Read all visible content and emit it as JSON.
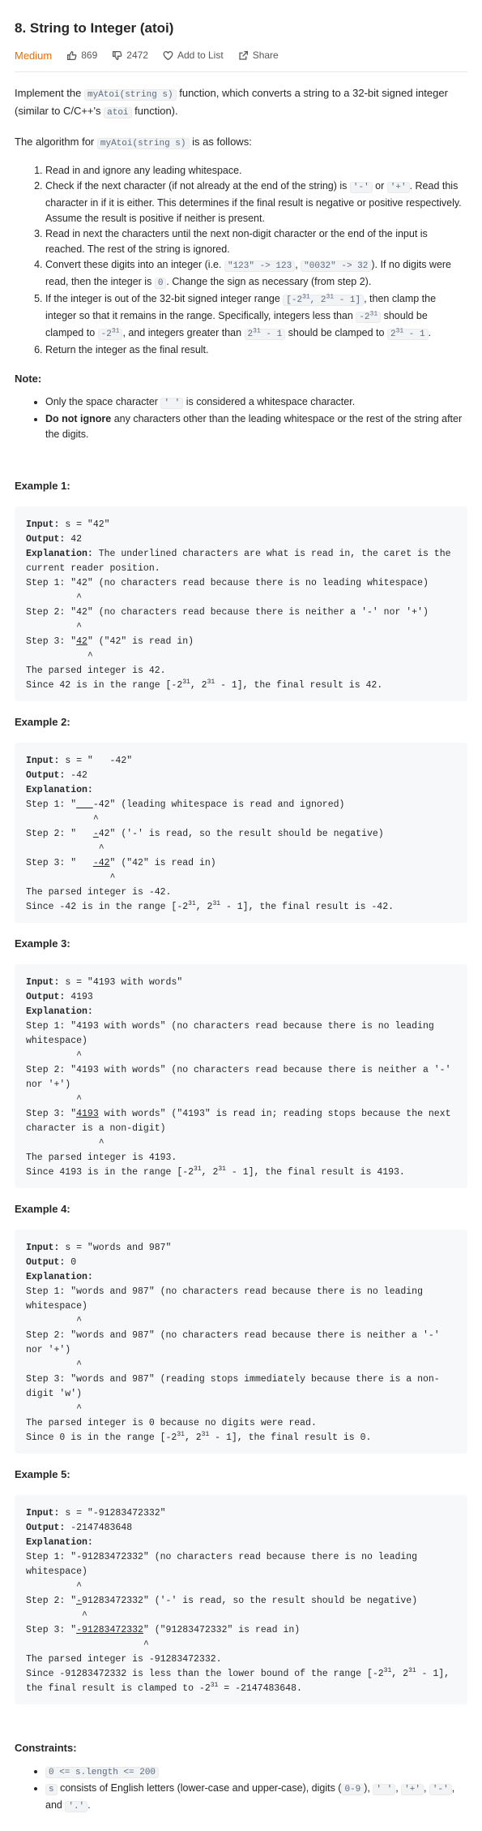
{
  "problem": {
    "title": "8. String to Integer (atoi)",
    "difficulty": "Medium",
    "likes": "869",
    "dislikes": "2472",
    "add_to_list": "Add to List",
    "share": "Share"
  },
  "intro": {
    "p1_a": "Implement the ",
    "p1_code1": "myAtoi(string s)",
    "p1_b": " function, which converts a string to a 32-bit signed integer (similar to C/C++'s ",
    "p1_code2": "atoi",
    "p1_c": " function).",
    "p2_a": "The algorithm for ",
    "p2_code": "myAtoi(string s)",
    "p2_b": " is as follows:"
  },
  "steps": {
    "s1": "Read in and ignore any leading whitespace.",
    "s2_a": "Check if the next character (if not already at the end of the string) is ",
    "s2_c1": "'-'",
    "s2_b": " or ",
    "s2_c2": "'+'",
    "s2_c": ". Read this character in if it is either. This determines if the final result is negative or positive respectively. Assume the result is positive if neither is present.",
    "s3": "Read in next the characters until the next non-digit character or the end of the input is reached. The rest of the string is ignored.",
    "s4_a": "Convert these digits into an integer (i.e. ",
    "s4_c1": "\"123\" -> 123",
    "s4_b": ", ",
    "s4_c2": "\"0032\" -> 32",
    "s4_c": "). If no digits were read, then the integer is ",
    "s4_c3": "0",
    "s4_d": ". Change the sign as necessary (from step 2).",
    "s5_a": "If the integer is out of the 32-bit signed integer range ",
    "s5_c1a": "[-2",
    "s5_c1s": "31",
    "s5_c1b": ", 2",
    "s5_c1s2": "31",
    "s5_c1c": " - 1]",
    "s5_b": ", then clamp the integer so that it remains in the range. Specifically, integers less than ",
    "s5_c2a": "-2",
    "s5_c2s": "31",
    "s5_c": " should be clamped to ",
    "s5_c3a": "-2",
    "s5_c3s": "31",
    "s5_d": ", and integers greater than ",
    "s5_c4a": "2",
    "s5_c4s": "31",
    "s5_c4b": " - 1",
    "s5_e": " should be clamped to ",
    "s5_c5a": "2",
    "s5_c5s": "31",
    "s5_c5b": " - 1",
    "s5_f": ".",
    "s6": "Return the integer as the final result."
  },
  "note": {
    "heading": "Note:",
    "n1_a": "Only the space character ",
    "n1_code": "' '",
    "n1_b": " is considered a whitespace character.",
    "n2_bold": "Do not ignore",
    "n2_b": " any characters other than the leading whitespace or the rest of the string after the digits."
  },
  "labels": {
    "input": "Input:",
    "output": "Output:",
    "explanation": "Explanation:"
  },
  "examples": [
    {
      "heading": "Example 1:",
      "input": " s = \"42\"",
      "output": " 42",
      "explanation": " The underlined characters are what is read in, the caret is the current reader position.",
      "step1": "Step 1: \"42\" (no characters read because there is no leading whitespace)",
      "caret1": "         ^",
      "step2": "Step 2: \"42\" (no characters read because there is neither a '-' nor '+')",
      "caret2": "         ^",
      "step3_a": "Step 3: \"",
      "step3_u": "42",
      "step3_b": "\" (\"42\" is read in)",
      "caret3": "           ^",
      "result1": "The parsed integer is 42.",
      "result2_a": "Since 42 is in the range [-2",
      "result2_s1": "31",
      "result2_b": ", 2",
      "result2_s2": "31",
      "result2_c": " - 1], the final result is 42."
    },
    {
      "heading": "Example 2:",
      "input": " s = \"   -42\"",
      "output": " -42",
      "step1_a": "Step 1: \"",
      "step1_u": "   ",
      "step1_b": "-42\" (leading whitespace is read and ignored)",
      "caret1": "            ^",
      "step2_a": "Step 2: \"   ",
      "step2_u": "-",
      "step2_b": "42\" ('-' is read, so the result should be negative)",
      "caret2": "             ^",
      "step3_a": "Step 3: \"   ",
      "step3_u": "-42",
      "step3_b": "\" (\"42\" is read in)",
      "caret3": "               ^",
      "result1": "The parsed integer is -42.",
      "result2_a": "Since -42 is in the range [-2",
      "result2_s1": "31",
      "result2_b": ", 2",
      "result2_s2": "31",
      "result2_c": " - 1], the final result is -42."
    },
    {
      "heading": "Example 3:",
      "input": " s = \"4193 with words\"",
      "output": " 4193",
      "step1": "Step 1: \"4193 with words\" (no characters read because there is no leading whitespace)",
      "caret1": "         ^",
      "step2": "Step 2: \"4193 with words\" (no characters read because there is neither a '-' nor '+')",
      "caret2": "         ^",
      "step3_a": "Step 3: \"",
      "step3_u": "4193",
      "step3_b": " with words\" (\"4193\" is read in; reading stops because the next character is a non-digit)",
      "caret3": "             ^",
      "result1": "The parsed integer is 4193.",
      "result2_a": "Since 4193 is in the range [-2",
      "result2_s1": "31",
      "result2_b": ", 2",
      "result2_s2": "31",
      "result2_c": " - 1], the final result is 4193."
    },
    {
      "heading": "Example 4:",
      "input": " s = \"words and 987\"",
      "output": " 0",
      "step1": "Step 1: \"words and 987\" (no characters read because there is no leading whitespace)",
      "caret1": "         ^",
      "step2": "Step 2: \"words and 987\" (no characters read because there is neither a '-' nor '+')",
      "caret2": "         ^",
      "step3": "Step 3: \"words and 987\" (reading stops immediately because there is a non-digit 'w')",
      "caret3": "         ^",
      "result1": "The parsed integer is 0 because no digits were read.",
      "result2_a": "Since 0 is in the range [-2",
      "result2_s1": "31",
      "result2_b": ", 2",
      "result2_s2": "31",
      "result2_c": " - 1], the final result is 0."
    },
    {
      "heading": "Example 5:",
      "input": " s = \"-91283472332\"",
      "output": " -2147483648",
      "step1": "Step 1: \"-91283472332\" (no characters read because there is no leading whitespace)",
      "caret1": "         ^",
      "step2_a": "Step 2: \"",
      "step2_u": "-",
      "step2_b": "91283472332\" ('-' is read, so the result should be negative)",
      "caret2": "          ^",
      "step3_a": "Step 3: \"",
      "step3_u": "-91283472332",
      "step3_b": "\" (\"91283472332\" is read in)",
      "caret3": "                     ^",
      "result1": "The parsed integer is -91283472332.",
      "result2_a": "Since -91283472332 is less than the lower bound of the range [-2",
      "result2_s1": "31",
      "result2_b": ", 2",
      "result2_s2": "31",
      "result2_c": " - 1], the final result is clamped to -2",
      "result2_s3": "31",
      "result2_d": " = -2147483648."
    }
  ],
  "constraints": {
    "heading": "Constraints:",
    "c1": "0 <= s.length <= 200",
    "c2_code": "s",
    "c2_a": " consists of English letters (lower-case and upper-case), digits (",
    "c2_c1": "0-9",
    "c2_b": "), ",
    "c2_c2": "' '",
    "c2_c": ", ",
    "c2_c3": "'+'",
    "c2_d": ", ",
    "c2_c4": "'-'",
    "c2_e": ", and ",
    "c2_c5": "'.'",
    "c2_f": "."
  }
}
